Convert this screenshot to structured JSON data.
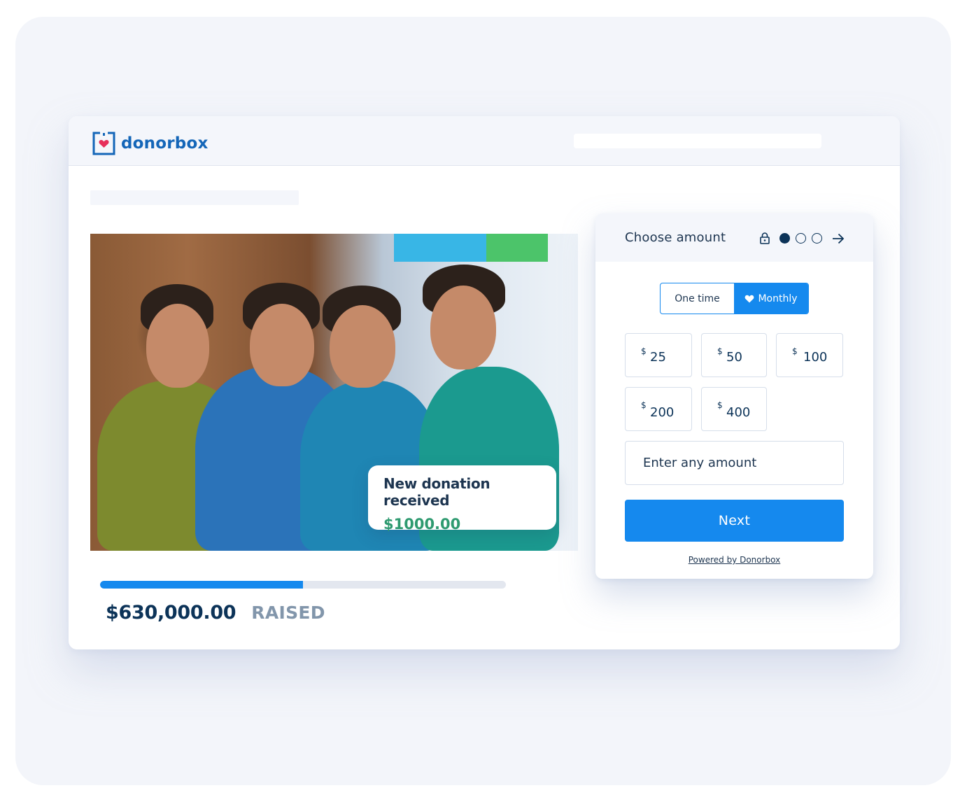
{
  "brand": {
    "name": "donorbox",
    "primary_color": "#1466b8",
    "heart_color": "#e7305b"
  },
  "campaign": {
    "photo_alt": "Four boys standing together smiling",
    "toast": {
      "title": "New donation received",
      "amount": "$1000.00",
      "amount_color": "#2e9a70"
    },
    "progress": {
      "fraction": 0.5,
      "fill_color": "#1589ee"
    },
    "raised_amount": "$630,000.00",
    "raised_label": "RAISED"
  },
  "form": {
    "title": "Choose amount",
    "steps": {
      "total": 3,
      "current": 1
    },
    "icons": {
      "lock": "lock-icon",
      "next": "arrow-right-icon",
      "heart": "heart-icon"
    },
    "frequency": {
      "options": [
        {
          "label": "One time",
          "selected": false
        },
        {
          "label": "Monthly",
          "selected": true
        }
      ]
    },
    "currency_symbol": "$",
    "amounts": [
      "25",
      "50",
      "100",
      "200",
      "400"
    ],
    "custom_amount_placeholder": "Enter any amount",
    "next_label": "Next",
    "powered_by": "Powered by Donorbox",
    "accent_color": "#1589ee"
  }
}
